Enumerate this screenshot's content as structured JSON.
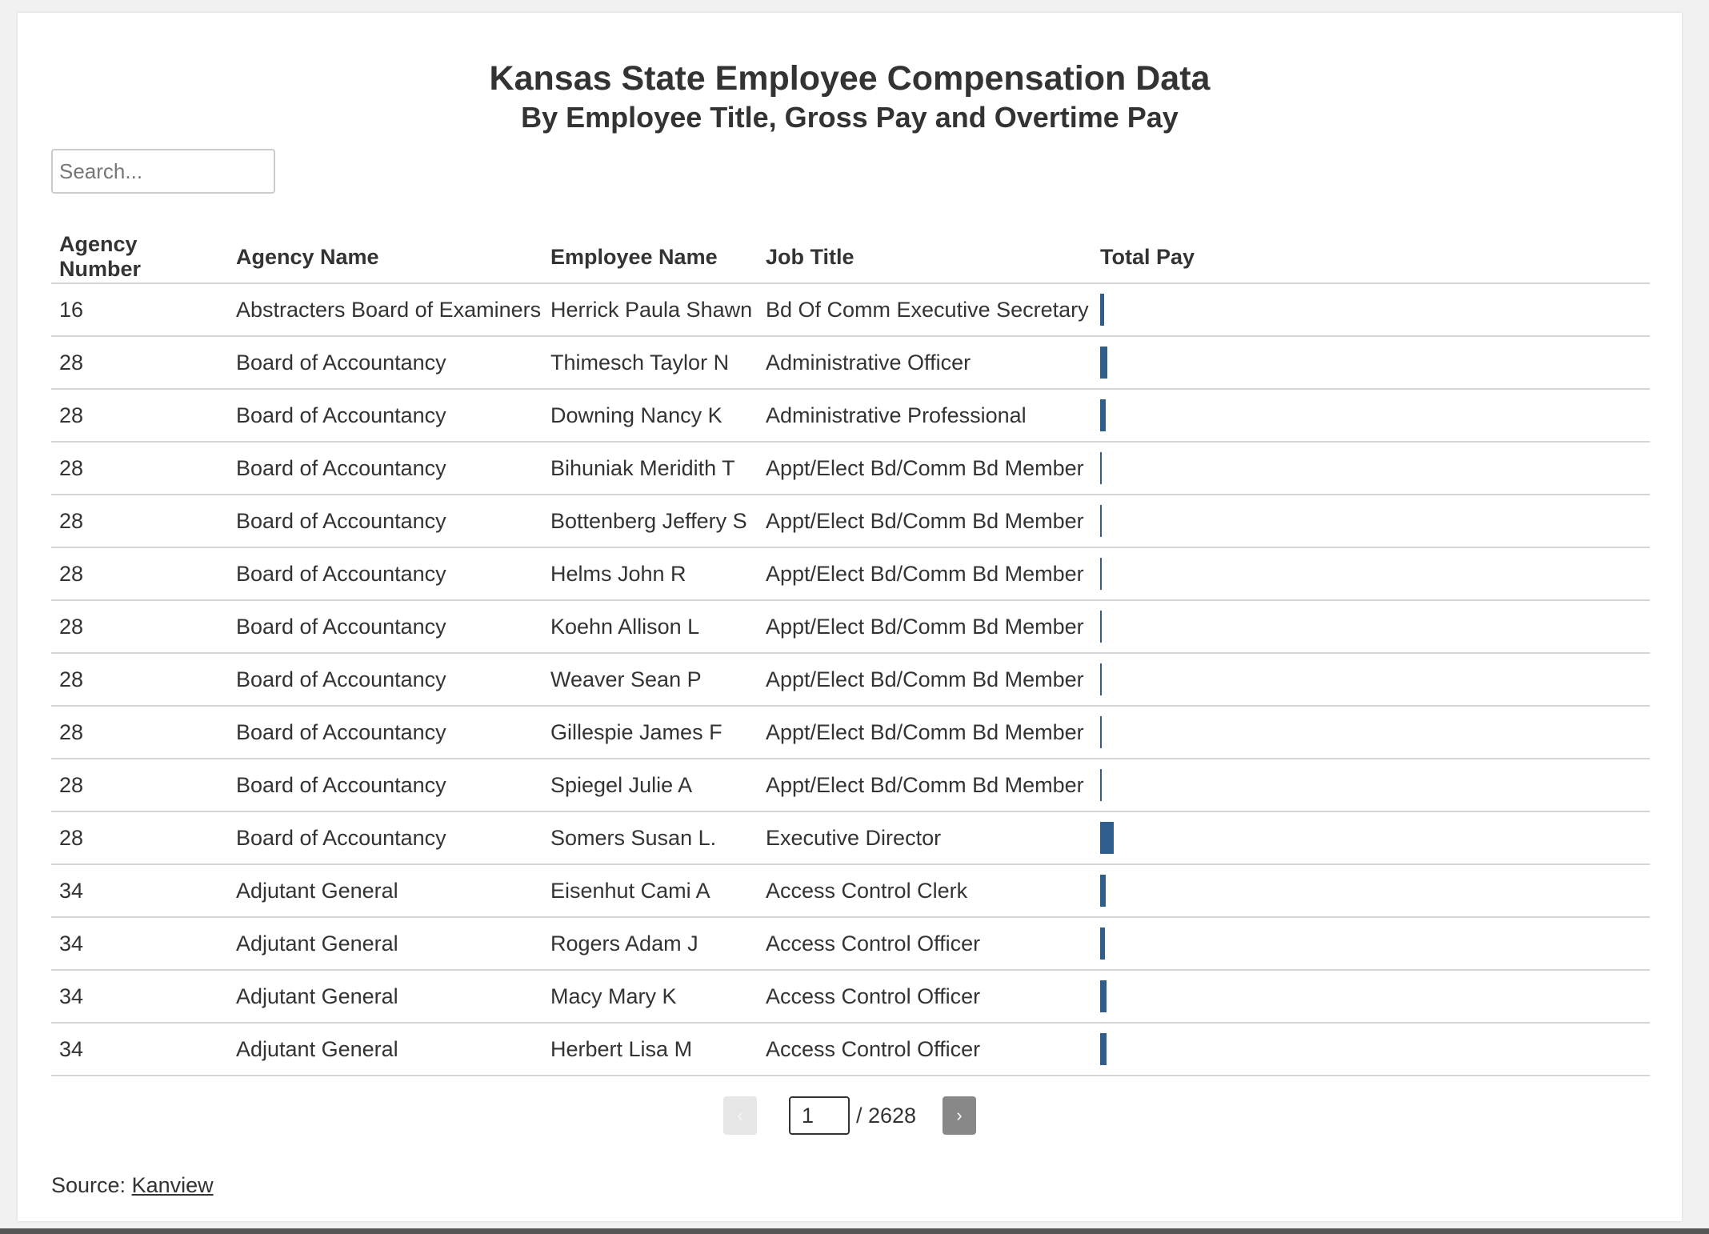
{
  "header": {
    "title": "Kansas State Employee Compensation Data",
    "subtitle": "By Employee Title, Gross Pay and Overtime Pay"
  },
  "search": {
    "placeholder": "Search..."
  },
  "table": {
    "columns": [
      "Agency Number",
      "Agency Name",
      "Employee Name",
      "Job Title",
      "Total Pay"
    ],
    "rows": [
      {
        "agency_number": "16",
        "agency_name": "Abstracters Board of Examiners",
        "employee_name": "Herrick Paula Shawn",
        "job_title": "Bd Of Comm Executive Secretary",
        "pay_level": 0.18
      },
      {
        "agency_number": "28",
        "agency_name": "Board of Accountancy",
        "employee_name": "Thimesch Taylor N",
        "job_title": "Administrative Officer",
        "pay_level": 0.3
      },
      {
        "agency_number": "28",
        "agency_name": "Board of Accountancy",
        "employee_name": "Downing Nancy K",
        "job_title": "Administrative Professional",
        "pay_level": 0.22
      },
      {
        "agency_number": "28",
        "agency_name": "Board of Accountancy",
        "employee_name": "Bihuniak Meridith T",
        "job_title": "Appt/Elect Bd/Comm Bd Member",
        "pay_level": 0.01
      },
      {
        "agency_number": "28",
        "agency_name": "Board of Accountancy",
        "employee_name": "Bottenberg Jeffery S",
        "job_title": "Appt/Elect Bd/Comm Bd Member",
        "pay_level": 0.01
      },
      {
        "agency_number": "28",
        "agency_name": "Board of Accountancy",
        "employee_name": "Helms John R",
        "job_title": "Appt/Elect Bd/Comm Bd Member",
        "pay_level": 0.01
      },
      {
        "agency_number": "28",
        "agency_name": "Board of Accountancy",
        "employee_name": "Koehn Allison L",
        "job_title": "Appt/Elect Bd/Comm Bd Member",
        "pay_level": 0.01
      },
      {
        "agency_number": "28",
        "agency_name": "Board of Accountancy",
        "employee_name": "Weaver Sean P",
        "job_title": "Appt/Elect Bd/Comm Bd Member",
        "pay_level": 0.01
      },
      {
        "agency_number": "28",
        "agency_name": "Board of Accountancy",
        "employee_name": "Gillespie James F",
        "job_title": "Appt/Elect Bd/Comm Bd Member",
        "pay_level": 0.01
      },
      {
        "agency_number": "28",
        "agency_name": "Board of Accountancy",
        "employee_name": "Spiegel Julie A",
        "job_title": "Appt/Elect Bd/Comm Bd Member",
        "pay_level": 0.01
      },
      {
        "agency_number": "28",
        "agency_name": "Board of Accountancy",
        "employee_name": "Somers Susan L.",
        "job_title": "Executive Director",
        "pay_level": 0.55
      },
      {
        "agency_number": "34",
        "agency_name": "Adjutant General",
        "employee_name": "Eisenhut Cami A",
        "job_title": "Access Control Clerk",
        "pay_level": 0.22
      },
      {
        "agency_number": "34",
        "agency_name": "Adjutant General",
        "employee_name": "Rogers Adam J",
        "job_title": "Access Control Officer",
        "pay_level": 0.2
      },
      {
        "agency_number": "34",
        "agency_name": "Adjutant General",
        "employee_name": "Macy Mary K",
        "job_title": "Access Control Officer",
        "pay_level": 0.26
      },
      {
        "agency_number": "34",
        "agency_name": "Adjutant General",
        "employee_name": "Herbert Lisa M",
        "job_title": "Access Control Officer",
        "pay_level": 0.26
      }
    ]
  },
  "pagination": {
    "prev_label": "‹",
    "next_label": "›",
    "current_page": "1",
    "total_text": "/ 2628"
  },
  "footer": {
    "source_label": "Source: ",
    "source_link": "Kanview"
  },
  "colors": {
    "bar": "#2e5e8b",
    "text": "#333333",
    "divider": "#d5d5d5"
  }
}
